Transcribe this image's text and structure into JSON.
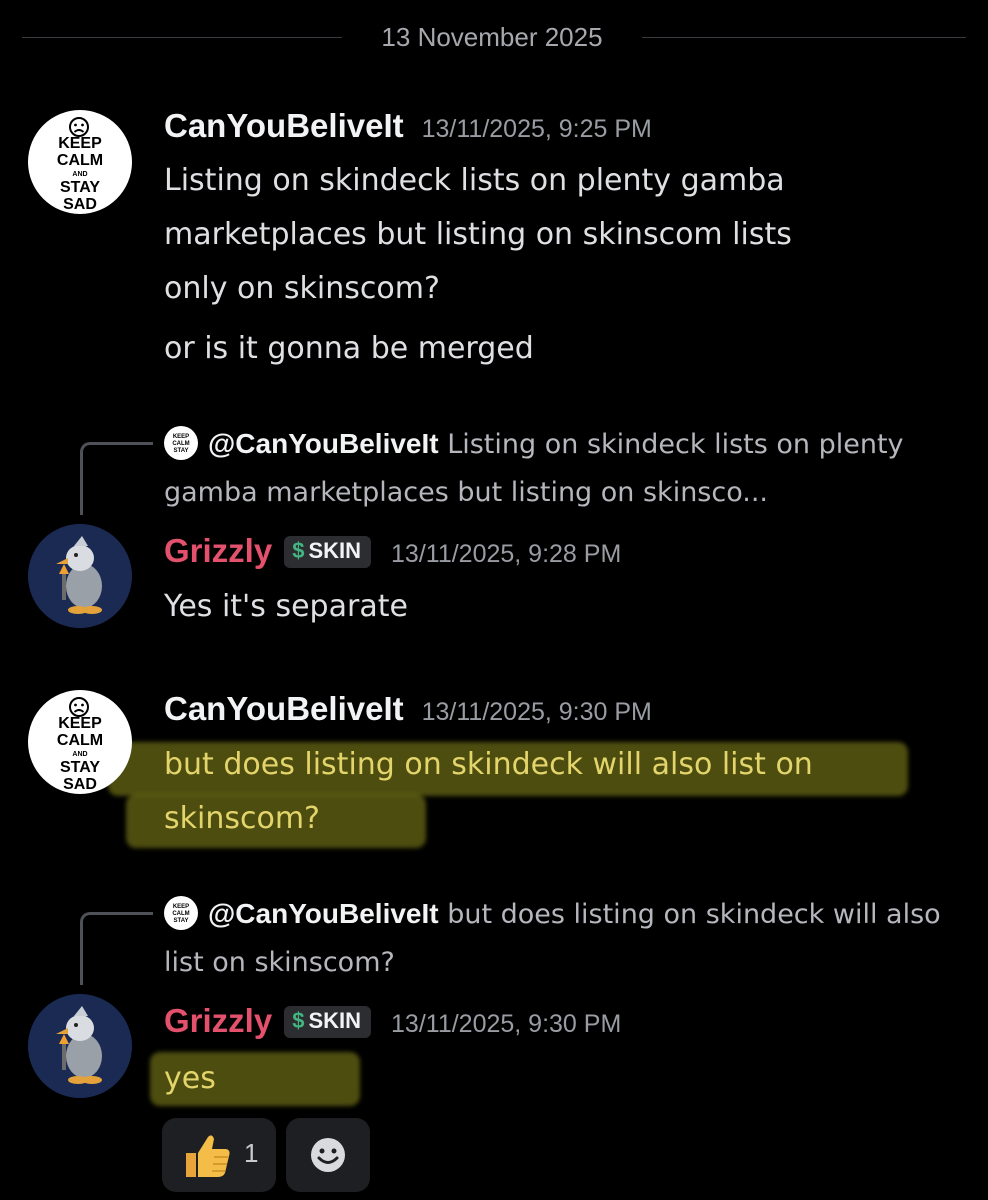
{
  "date_divider": "13 November 2025",
  "messages": [
    {
      "username": "CanYouBeliveIt",
      "timestamp": "13/11/2025, 9:25 PM",
      "lines": [
        "Listing on skindeck lists on plenty gamba",
        "marketplaces but listing on skinscom lists",
        "only on skinscom?"
      ],
      "followup": "or is it gonna be merged"
    },
    {
      "reply_to": {
        "mention": "@CanYouBeliveIt",
        "preview": " Listing on skindeck lists on plenty gamba marketplaces but listing on skinsco..."
      },
      "username": "Grizzly",
      "tag": "SKIN",
      "timestamp": "13/11/2025, 9:28 PM",
      "text": "Yes it's separate"
    },
    {
      "username": "CanYouBeliveIt",
      "timestamp": "13/11/2025, 9:30 PM",
      "lines": [
        "but does listing on skindeck will also list on",
        "skinscom?"
      ]
    },
    {
      "reply_to": {
        "mention": "@CanYouBeliveIt",
        "preview": " but does listing on skindeck will also list on skinscom?"
      },
      "username": "Grizzly",
      "tag": "SKIN",
      "timestamp": "13/11/2025, 9:30 PM",
      "text": "yes"
    }
  ],
  "avatar_keep_calm": {
    "line1": "KEEP",
    "line2": "CALM",
    "line3": "AND",
    "line4": "STAY",
    "line5": "SAD"
  },
  "reactions": [
    {
      "icon": "thumbs-up-icon",
      "emoji": "👍",
      "count": "1"
    },
    {
      "icon": "add-reaction-icon"
    }
  ],
  "colors": {
    "background": "#000000",
    "grizzly_name": "#e3516d",
    "skin_tag_icon": "#43b581",
    "highlight": "#8c8c1e"
  }
}
